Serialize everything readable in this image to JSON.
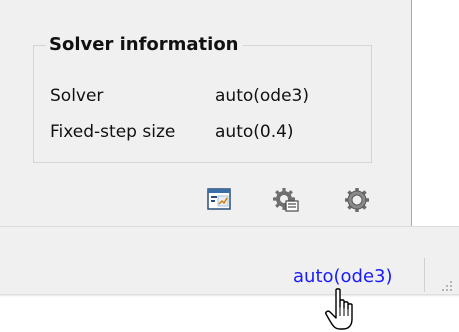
{
  "solver_info": {
    "title": "Solver information",
    "rows": [
      {
        "label": "Solver",
        "value": "auto(ode3)"
      },
      {
        "label": "Fixed-step size",
        "value": "auto(0.4)"
      }
    ]
  },
  "toolbar": {
    "icons": [
      "model-explorer-icon",
      "solver-settings-icon",
      "configuration-gear-icon"
    ]
  },
  "statusbar": {
    "solver_link": "auto(ode3)"
  },
  "colors": {
    "panel_bg": "#f0f0f0",
    "link": "#1a1aff"
  }
}
